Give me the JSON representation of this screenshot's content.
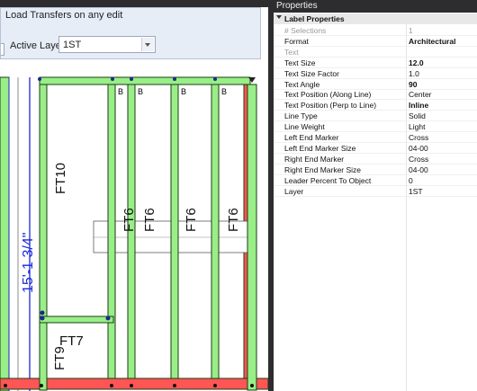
{
  "toolbar": {
    "load_transfers_label": "Load Transfers on any edit",
    "active_layer_label": "Active Layer:",
    "active_layer_value": "1ST"
  },
  "drawing": {
    "dimension_text": "15'-1 3/4\"",
    "header_labels": [
      "B",
      "B",
      "B",
      "B"
    ],
    "stud_labels": [
      "FT10",
      "FT6",
      "FT6",
      "FT6",
      "FT6",
      "FT7",
      "FT9"
    ],
    "colors": {
      "stud_fill": "#99ee88",
      "stud_edge": "#1a3d10",
      "plate_red": "#ff5555",
      "dimension": "#1a28d8",
      "header_fill": "#99ee88"
    }
  },
  "properties": {
    "title": "Properties",
    "group_header": "Label Properties",
    "rows": [
      {
        "key": "# Selections",
        "value": "1",
        "disabled": true,
        "bold": false
      },
      {
        "key": "Format",
        "value": "Architectural",
        "disabled": false,
        "bold": true
      },
      {
        "key": "Text",
        "value": "",
        "disabled": true,
        "bold": false
      },
      {
        "key": "Text Size",
        "value": "12.0",
        "disabled": false,
        "bold": true
      },
      {
        "key": "Text Size Factor",
        "value": "1.0",
        "disabled": false,
        "bold": false
      },
      {
        "key": "Text Angle",
        "value": "90",
        "disabled": false,
        "bold": true
      },
      {
        "key": "Text Position (Along Line)",
        "value": "Center",
        "disabled": false,
        "bold": false
      },
      {
        "key": "Text Position (Perp to Line)",
        "value": "Inline",
        "disabled": false,
        "bold": true
      },
      {
        "key": "Line Type",
        "value": "Solid",
        "disabled": false,
        "bold": false
      },
      {
        "key": "Line Weight",
        "value": "Light",
        "disabled": false,
        "bold": false
      },
      {
        "key": "Left End Marker",
        "value": "Cross",
        "disabled": false,
        "bold": false
      },
      {
        "key": "Left End Marker Size",
        "value": "04-00",
        "disabled": false,
        "bold": false
      },
      {
        "key": "Right End Marker",
        "value": "Cross",
        "disabled": false,
        "bold": false
      },
      {
        "key": "Right End Marker Size",
        "value": "04-00",
        "disabled": false,
        "bold": false
      },
      {
        "key": "Leader Percent To Object",
        "value": "0",
        "disabled": false,
        "bold": false
      },
      {
        "key": "Layer",
        "value": "1ST",
        "disabled": false,
        "bold": false
      }
    ]
  }
}
